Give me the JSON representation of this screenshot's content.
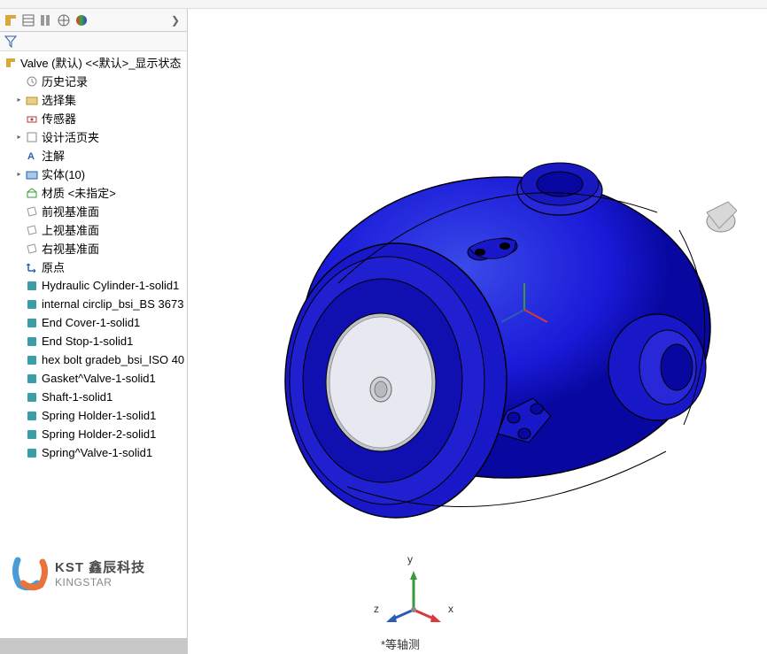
{
  "root_label": "Valve (默认) <<默认>_显示状态",
  "tree": {
    "history": "历史记录",
    "selection_sets": "选择集",
    "sensors": "传感器",
    "design_binder": "设计活页夹",
    "annotations": "注解",
    "solid_bodies": "实体(10)",
    "material": "材质 <未指定>",
    "front_plane": "前视基准面",
    "top_plane": "上视基准面",
    "right_plane": "右视基准面",
    "origin": "原点",
    "b1": "Hydraulic Cylinder-1-solid1",
    "b2": "internal circlip_bsi_BS 3673",
    "b3": "End Cover-1-solid1",
    "b4": "End Stop-1-solid1",
    "b5": "hex bolt gradeb_bsi_ISO 40",
    "b6": "Gasket^Valve-1-solid1",
    "b7": "Shaft-1-solid1",
    "b8": "Spring Holder-1-solid1",
    "b9": "Spring Holder-2-solid1",
    "b10": "Spring^Valve-1-solid1"
  },
  "logo": {
    "line1": "KST 鑫辰科技",
    "line2": "KINGSTAR"
  },
  "view_name": "*等轴测",
  "axes": {
    "x": "x",
    "y": "y",
    "z": "z"
  }
}
